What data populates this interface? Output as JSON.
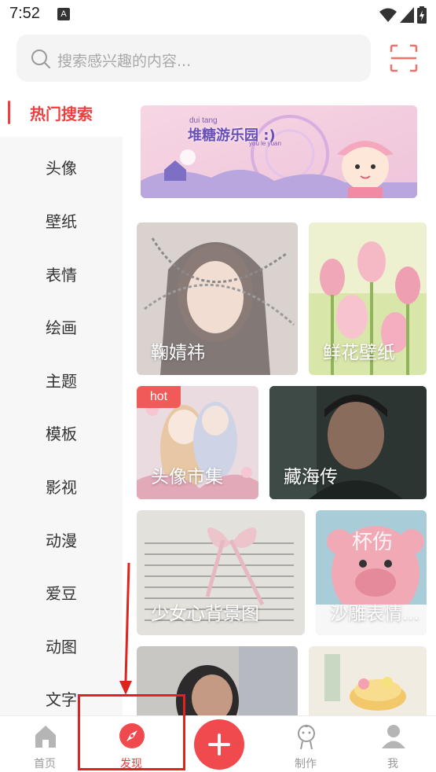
{
  "status_bar": {
    "time": "7:52",
    "notification_badge": "A"
  },
  "search": {
    "placeholder": "搜索感兴趣的内容..."
  },
  "sidebar": {
    "items": [
      {
        "label": "热门搜索",
        "active": true
      },
      {
        "label": "头像"
      },
      {
        "label": "壁纸"
      },
      {
        "label": "表情"
      },
      {
        "label": "绘画"
      },
      {
        "label": "主题"
      },
      {
        "label": "模板"
      },
      {
        "label": "影视"
      },
      {
        "label": "动漫"
      },
      {
        "label": "爱豆"
      },
      {
        "label": "动图"
      },
      {
        "label": "文字"
      }
    ]
  },
  "banner": {
    "title": "堆糖游乐园 :)",
    "romanization_top": "dui tang",
    "romanization_bottom": "you le yuan"
  },
  "cards": [
    {
      "label": "鞠婧祎"
    },
    {
      "label": "鲜花壁纸"
    },
    {
      "label": "头像市集",
      "badge": "hot"
    },
    {
      "label": "藏海传"
    },
    {
      "label": "少女心背景图"
    },
    {
      "label": "沙雕表情..."
    },
    {
      "label": ""
    },
    {
      "label": ""
    }
  ],
  "card_image_text": {
    "bear_label": "杯伤"
  },
  "bottom_nav": {
    "items": [
      {
        "label": "首页"
      },
      {
        "label": "发现",
        "active": true
      },
      {
        "label": "制作"
      },
      {
        "label": "我"
      }
    ]
  },
  "colors": {
    "accent": "#EE3F3F",
    "fab": "#F04A4E"
  }
}
